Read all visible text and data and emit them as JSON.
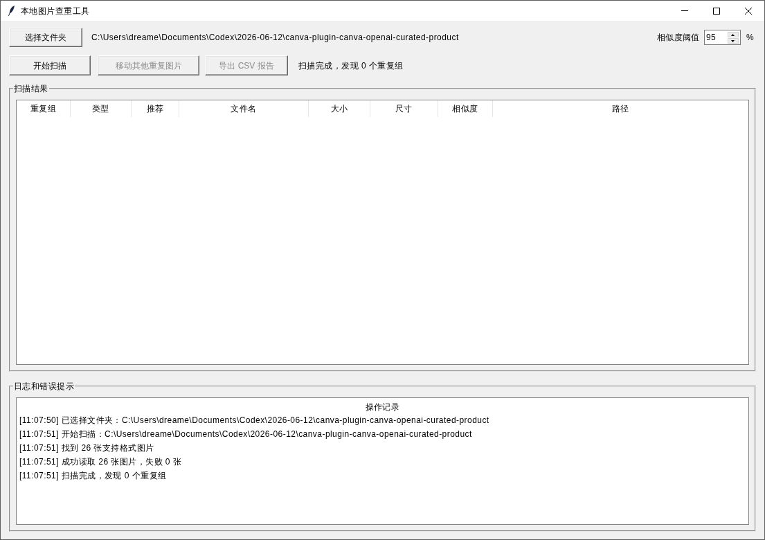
{
  "window": {
    "title": "本地图片查重工具"
  },
  "folder_row": {
    "choose_button": "选择文件夹",
    "path": "C:\\Users\\dreame\\Documents\\Codex\\2026-06-12\\canva-plugin-canva-openai-curated-product",
    "threshold_label": "相似度阈值",
    "threshold_value": "95",
    "unit": "%"
  },
  "action_buttons": [
    {
      "label": "开始扫描",
      "disabled": false
    },
    {
      "label": "移动其他重复图片",
      "disabled": true
    },
    {
      "label": "导出 CSV 报告",
      "disabled": true
    }
  ],
  "status": "扫描完成，发现 0 个重复组",
  "results": {
    "title": "扫描结果",
    "columns": [
      "重复组",
      "类型",
      "推荐",
      "文件名",
      "大小",
      "尺寸",
      "相似度",
      "路径"
    ]
  },
  "log": {
    "title": "日志和错误提示",
    "heading": "操作记录",
    "lines": [
      "[11:07:50] 已选择文件夹：C:\\Users\\dreame\\Documents\\Codex\\2026-06-12\\canva-plugin-canva-openai-curated-product",
      "[11:07:51] 开始扫描：C:\\Users\\dreame\\Documents\\Codex\\2026-06-12\\canva-plugin-canva-openai-curated-product",
      "[11:07:51] 找到 26 张支持格式图片",
      "[11:07:51] 成功读取 26 张图片，失败 0 张",
      "[11:07:51] 扫描完成，发现 0 个重复组"
    ]
  }
}
